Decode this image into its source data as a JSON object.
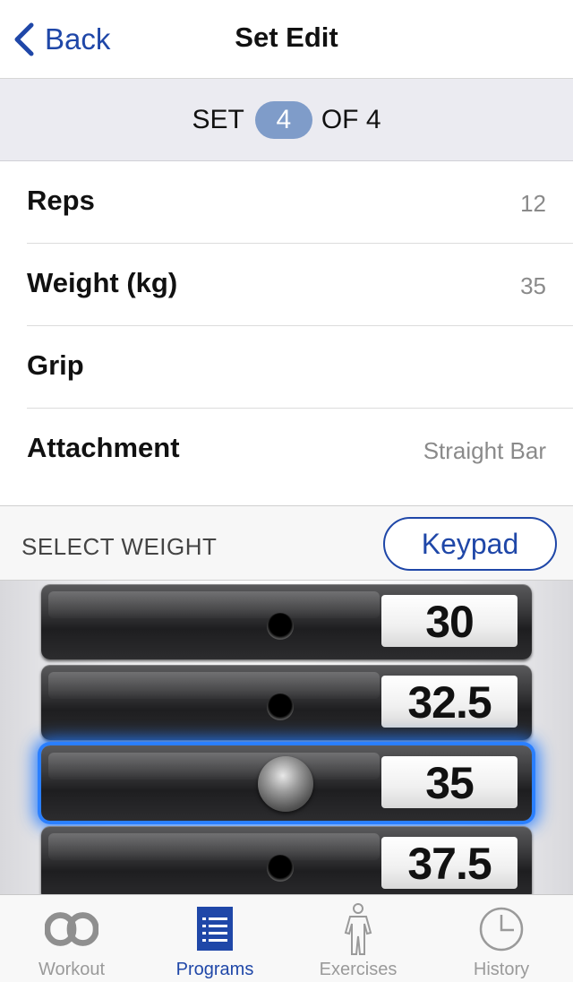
{
  "nav": {
    "back_label": "Back",
    "title": "Set Edit"
  },
  "set_indicator": {
    "prefix": "SET",
    "current": "4",
    "suffix": "OF 4"
  },
  "fields": [
    {
      "label": "Reps",
      "value": "12"
    },
    {
      "label": "Weight (kg)",
      "value": "35"
    },
    {
      "label": "Grip",
      "value": ""
    },
    {
      "label": "Attachment",
      "value": "Straight Bar"
    }
  ],
  "select_weight": {
    "label": "SELECT WEIGHT",
    "keypad_label": "Keypad"
  },
  "picker": {
    "plates": [
      "30",
      "32.5",
      "35",
      "37.5"
    ],
    "selected": "35"
  },
  "tabs": [
    {
      "label": "Workout",
      "icon": "chain-icon",
      "active": false
    },
    {
      "label": "Programs",
      "icon": "list-icon",
      "active": true
    },
    {
      "label": "Exercises",
      "icon": "body-icon",
      "active": false
    },
    {
      "label": "History",
      "icon": "clock-icon",
      "active": false
    }
  ],
  "colors": {
    "accent": "#1f47a8",
    "pill": "#7f9cc9",
    "selection_glow": "#2a7fff",
    "inactive": "#9a9a9a"
  }
}
